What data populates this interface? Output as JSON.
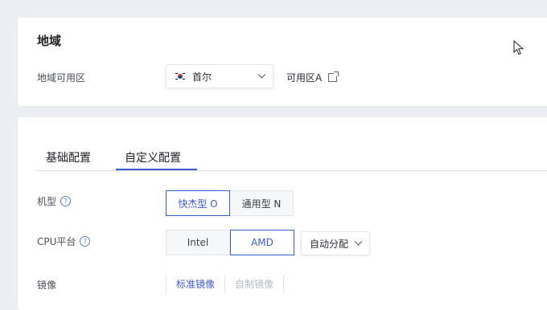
{
  "region": {
    "title": "地域",
    "row_label": "地域可用区",
    "selected_region": "首尔",
    "zone": "可用区A"
  },
  "config": {
    "tabs": [
      "基础配置",
      "自定义配置"
    ],
    "active_tab": "自定义配置",
    "instance_type": {
      "label": "机型",
      "options": [
        "快杰型 O",
        "通用型 N"
      ],
      "selected": "快杰型 O"
    },
    "cpu_platform": {
      "label": "CPU平台",
      "options": [
        "Intel",
        "AMD"
      ],
      "selected": "AMD",
      "allocation": "自动分配"
    },
    "image": {
      "label": "镜像",
      "tabs": [
        "标准镜像",
        "自制镜像"
      ],
      "selected": "标准镜像"
    }
  },
  "colors": {
    "accent": "#3e5bd4",
    "background": "#eceef3"
  }
}
